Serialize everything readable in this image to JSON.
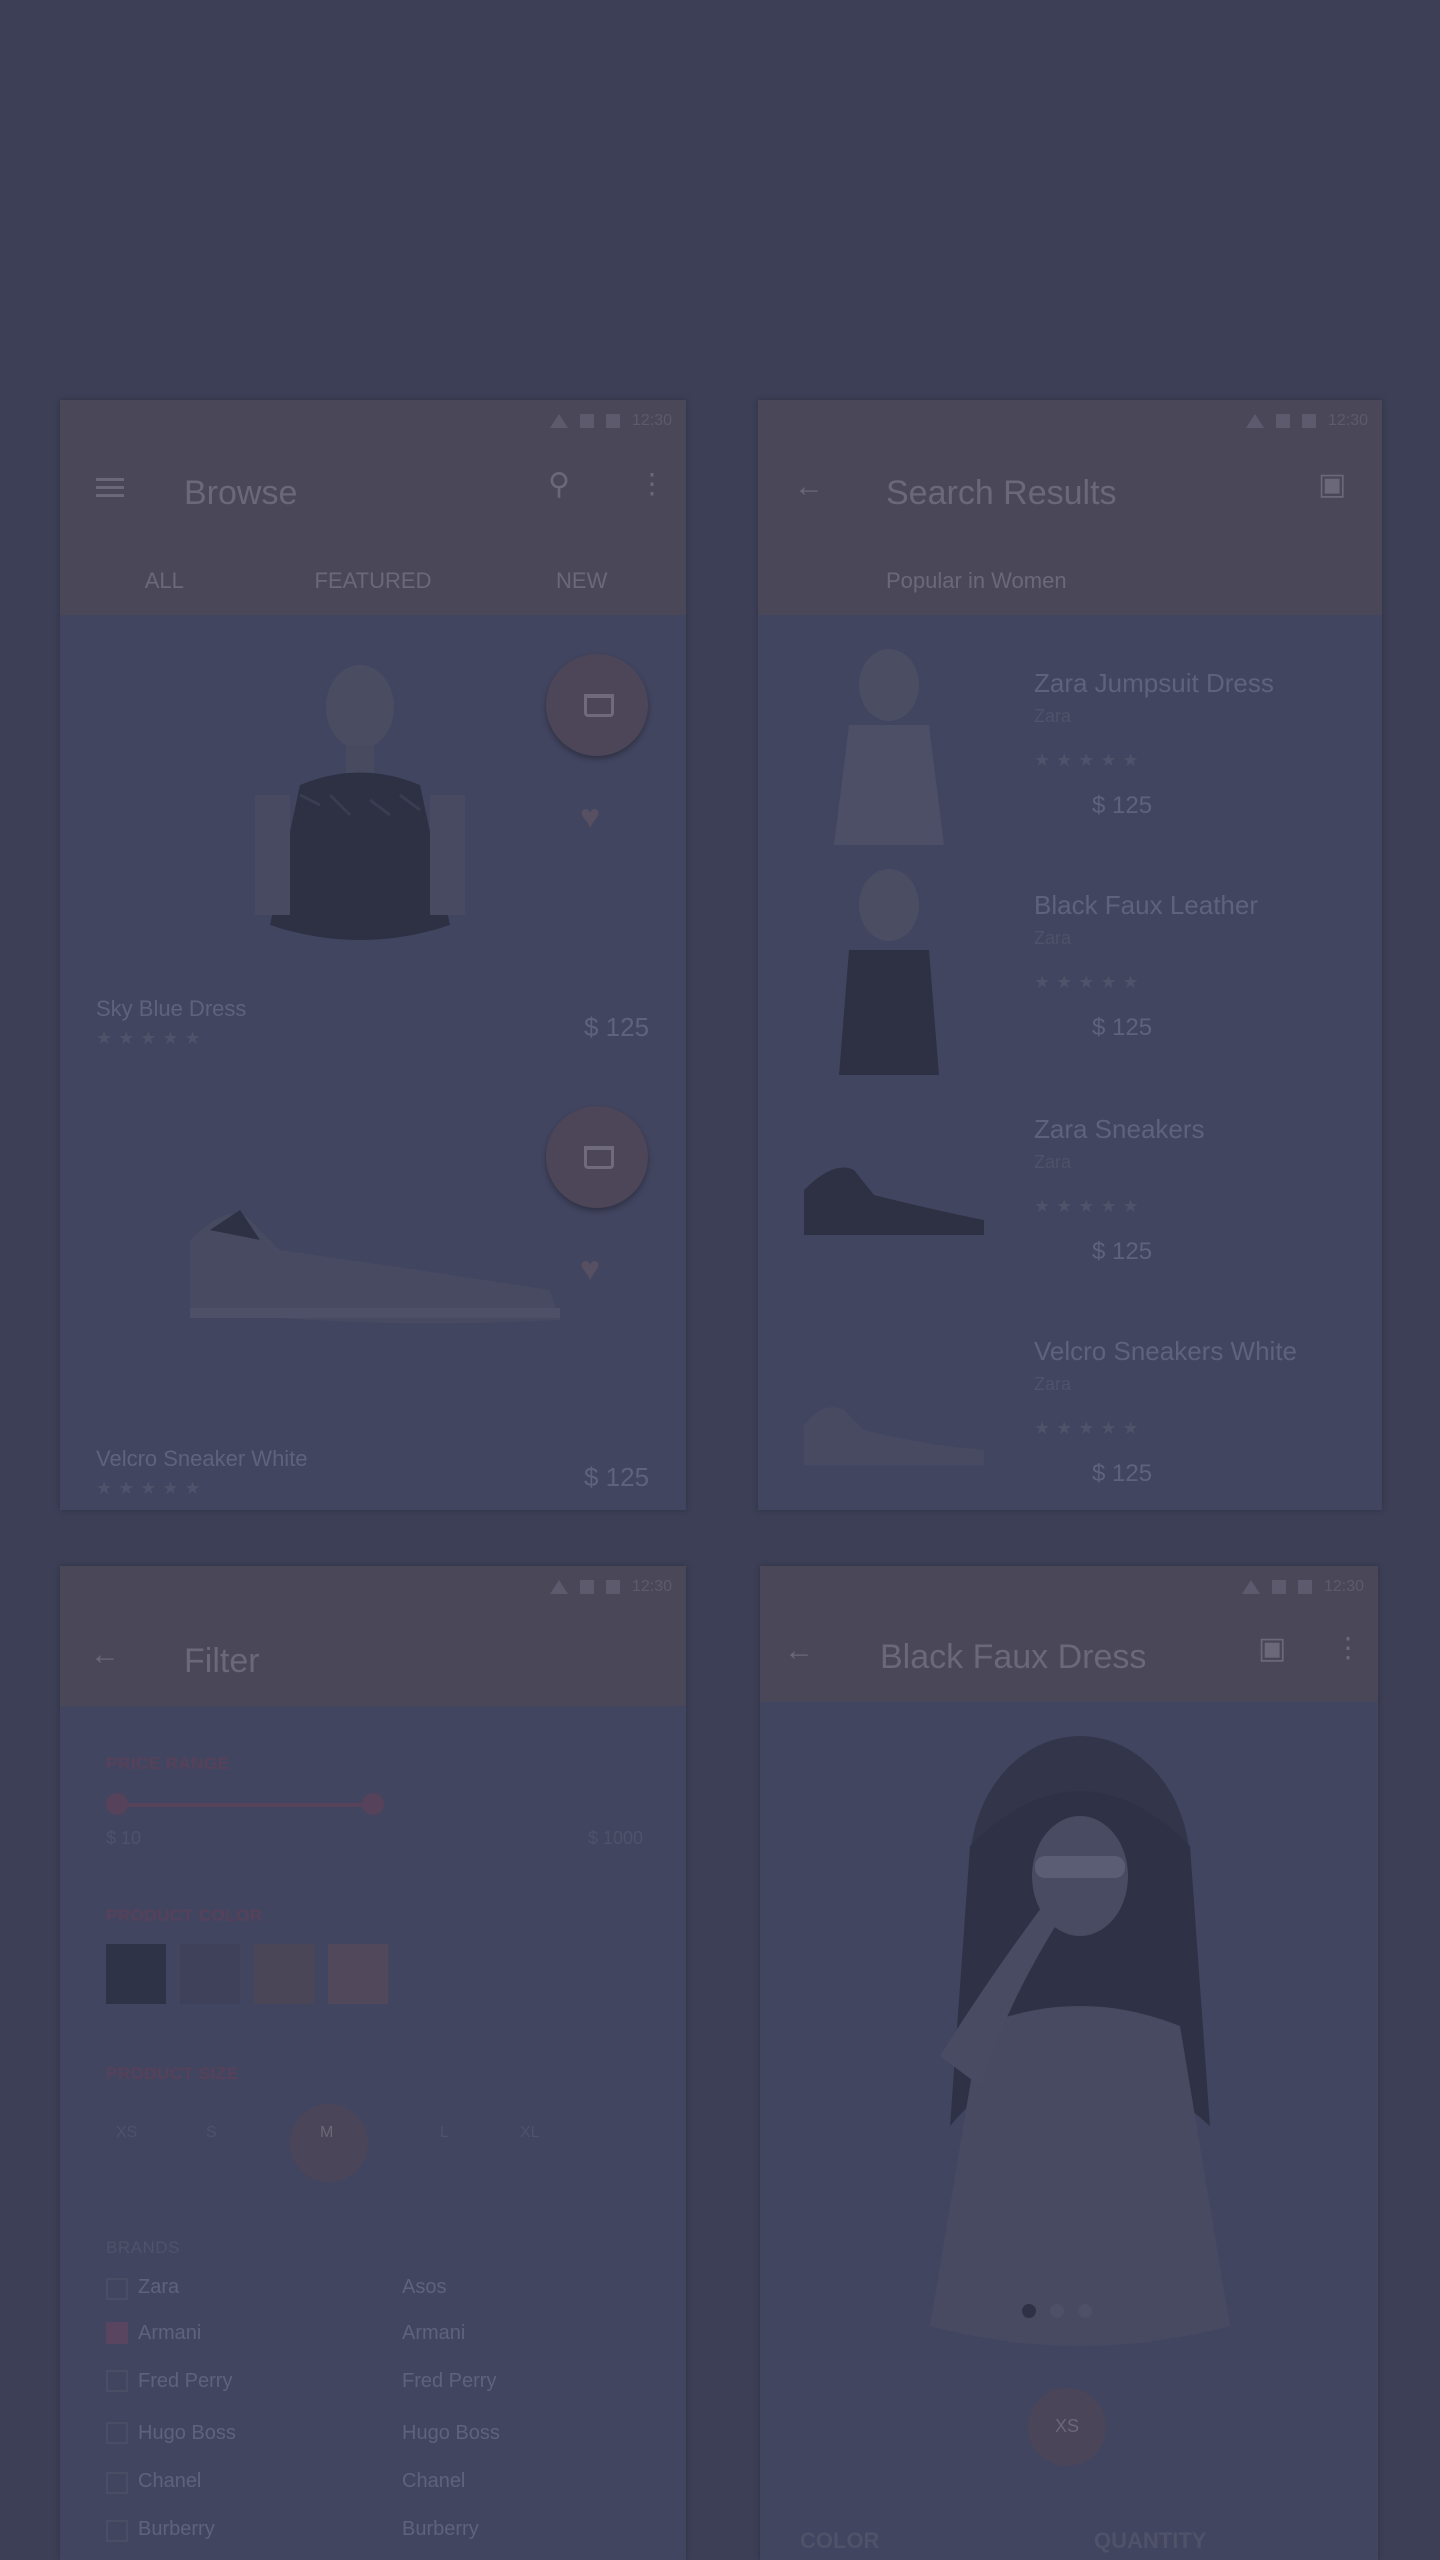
{
  "colors": {
    "background": "#3d3f57",
    "appbar": "#4a4759",
    "accent": "#4c4658",
    "card": "#424560"
  },
  "status": {
    "time": "12:30"
  },
  "phone1": {
    "title": "Browse",
    "tabs": [
      "ALL",
      "FEATURED",
      "NEW"
    ],
    "products": [
      {
        "name": "Sky Blue Dress",
        "price": "$ 125"
      },
      {
        "name": "Velcro Sneaker White",
        "price": "$ 125"
      }
    ]
  },
  "phone2": {
    "title": "Search Results",
    "subtitle": "Popular in Women",
    "items": [
      {
        "name": "Zara Jumpsuit Dress",
        "brand": "Zara",
        "price": "$ 125"
      },
      {
        "name": "Black Faux Leather",
        "brand": "Zara",
        "price": "$ 125"
      },
      {
        "name": "Zara Sneakers",
        "brand": "Zara",
        "price": "$ 125"
      },
      {
        "name": "Velcro Sneakers White",
        "brand": "Zara",
        "price": "$ 125"
      }
    ]
  },
  "phone3": {
    "title": "Filter",
    "price_label": "PRICE RANGE",
    "price_min": "$ 10",
    "price_max": "$ 1000",
    "color_label": "PRODUCT COLOR",
    "size_label": "PRODUCT SIZE",
    "sizes": [
      "XS",
      "S",
      "M",
      "L",
      "XL"
    ],
    "selected_size": "M",
    "brands_label": "BRANDS",
    "brands_left": [
      "Zara",
      "Armani",
      "Fred Perry",
      "Hugo Boss",
      "Chanel",
      "Burberry"
    ],
    "brands_right": [
      "Asos",
      "Armani",
      "Fred Perry",
      "Hugo Boss",
      "Chanel",
      "Burberry"
    ],
    "swatches": [
      "#2f3347",
      "#3d3f57",
      "#4b4558",
      "#52485b"
    ]
  },
  "phone4": {
    "title": "Black Faux Dress",
    "size_badge": "XS",
    "color_label": "COLOR",
    "quantity_label": "QUANTITY"
  }
}
